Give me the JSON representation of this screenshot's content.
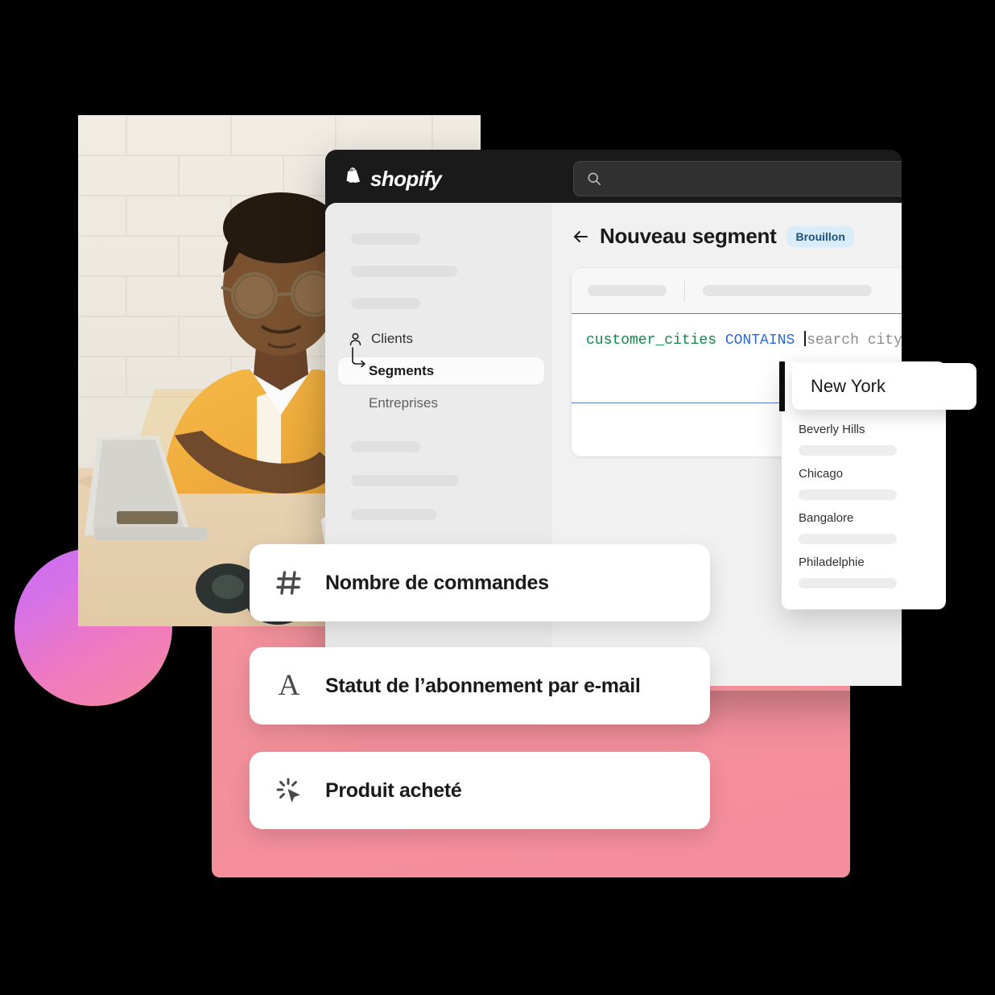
{
  "window": {
    "brand": "shopify",
    "brand_icon": "shopify-bag-icon",
    "search": {
      "icon": "search-icon",
      "value": "",
      "placeholder": ""
    }
  },
  "sidebar": {
    "items": [
      {
        "label": "Clients",
        "icon": "person-icon",
        "active": false
      },
      {
        "label": "Segments",
        "icon": "branch-arrow-icon",
        "active": true
      },
      {
        "label": "Entreprises",
        "icon": "",
        "active": false
      }
    ]
  },
  "main": {
    "back_icon": "arrow-left-icon",
    "title": "Nouveau segment",
    "status_badge": "Brouillon"
  },
  "query": {
    "field": "customer_cities",
    "operator": "CONTAINS",
    "placeholder": "search city",
    "colors": {
      "field": "#0e8a47",
      "operator": "#2d6adf",
      "placeholder": "#8c8c8c",
      "border": "#5b79d6"
    }
  },
  "autocomplete": {
    "selected": "New York",
    "options": [
      {
        "label": "Beverly Hills"
      },
      {
        "label": "Chicago"
      },
      {
        "label": "Bangalore"
      },
      {
        "label": "Philadelphie"
      }
    ]
  },
  "feature_cards": [
    {
      "icon": "hash-icon",
      "label": "Nombre de commandes"
    },
    {
      "icon": "letter-a-icon",
      "label": "A",
      "text": "Statut de l’abonnement par e-mail"
    },
    {
      "icon": "cursor-click-icon",
      "label": "Produit acheté"
    }
  ],
  "decor": {
    "circle_gradient_from": "#c96ef0",
    "circle_gradient_to": "#f58aa3",
    "panel_color": "#f2909a"
  }
}
